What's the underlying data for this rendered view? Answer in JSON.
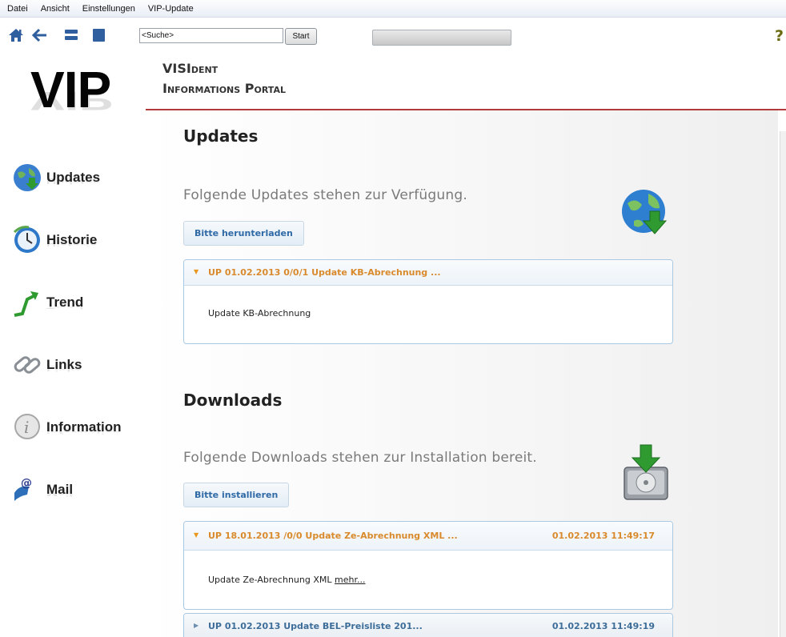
{
  "menu": [
    "Datei",
    "Ansicht",
    "Einstellungen",
    "VIP-Update"
  ],
  "toolbar": {
    "search_value": "<Suche>",
    "start_label": "Start",
    "help_glyph": "?"
  },
  "sidebar": {
    "logo": "VIP",
    "items": [
      {
        "label": "Updates",
        "icon": "globe-download-icon"
      },
      {
        "label": "Historie",
        "icon": "clock-icon"
      },
      {
        "label": "Trend",
        "icon": "trend-arrow-icon"
      },
      {
        "label": "Links",
        "icon": "chain-link-icon"
      },
      {
        "label": "Information",
        "icon": "info-icon"
      },
      {
        "label": "Mail",
        "icon": "mail-icon"
      }
    ]
  },
  "header": {
    "line1": "VISIdent",
    "line2": "Informations Portal"
  },
  "updates": {
    "title": "Updates",
    "subtitle": "Folgende Updates stehen zur Verfügung.",
    "button": "Bitte herunterladen",
    "items": [
      {
        "title": "UP 01.02.2013 0/0/1 Update KB-Abrechnung ...",
        "body": "Update KB-Abrechnung"
      }
    ]
  },
  "downloads": {
    "title": "Downloads",
    "subtitle": "Folgende Downloads stehen zur Installation bereit.",
    "button": "Bitte installieren",
    "items": [
      {
        "title": "UP 18.01.2013 /0/0 Update Ze-Abrechnung XML ...",
        "date": "01.02.2013 11:49:17",
        "body": "Update Ze-Abrechnung XML",
        "link": "mehr..."
      },
      {
        "title": "UP 01.02.2013 Update BEL-Preisliste 201...",
        "date": "01.02.2013 11:49:19"
      }
    ]
  },
  "colors": {
    "accent_line": "#b23a3a",
    "accordion_title": "#d98a2c",
    "button_text": "#2f6aa6"
  }
}
